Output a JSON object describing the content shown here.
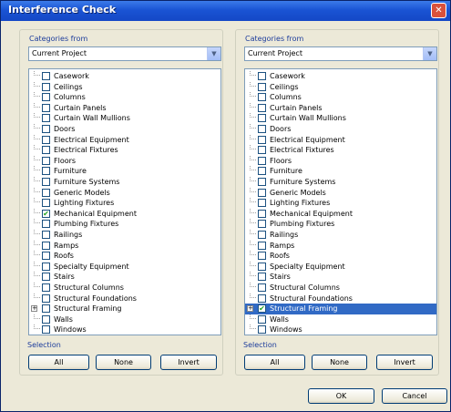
{
  "window": {
    "title": "Interference Check",
    "close_glyph": "✕"
  },
  "left_panel": {
    "categories_label": "Categories from",
    "source": "Current Project",
    "items": [
      {
        "label": "Casework",
        "checked": false,
        "selected": false
      },
      {
        "label": "Ceilings",
        "checked": false,
        "selected": false
      },
      {
        "label": "Columns",
        "checked": false,
        "selected": false
      },
      {
        "label": "Curtain Panels",
        "checked": false,
        "selected": false
      },
      {
        "label": "Curtain Wall Mullions",
        "checked": false,
        "selected": false
      },
      {
        "label": "Doors",
        "checked": false,
        "selected": false
      },
      {
        "label": "Electrical Equipment",
        "checked": false,
        "selected": false
      },
      {
        "label": "Electrical Fixtures",
        "checked": false,
        "selected": false
      },
      {
        "label": "Floors",
        "checked": false,
        "selected": false
      },
      {
        "label": "Furniture",
        "checked": false,
        "selected": false
      },
      {
        "label": "Furniture Systems",
        "checked": false,
        "selected": false
      },
      {
        "label": "Generic Models",
        "checked": false,
        "selected": false
      },
      {
        "label": "Lighting Fixtures",
        "checked": false,
        "selected": false
      },
      {
        "label": "Mechanical Equipment",
        "checked": true,
        "selected": false
      },
      {
        "label": "Plumbing Fixtures",
        "checked": false,
        "selected": false
      },
      {
        "label": "Railings",
        "checked": false,
        "selected": false
      },
      {
        "label": "Ramps",
        "checked": false,
        "selected": false
      },
      {
        "label": "Roofs",
        "checked": false,
        "selected": false
      },
      {
        "label": "Specialty Equipment",
        "checked": false,
        "selected": false
      },
      {
        "label": "Stairs",
        "checked": false,
        "selected": false
      },
      {
        "label": "Structural Columns",
        "checked": false,
        "selected": false
      },
      {
        "label": "Structural Foundations",
        "checked": false,
        "selected": false
      },
      {
        "label": "Structural Framing",
        "checked": false,
        "selected": false,
        "expandable": true
      },
      {
        "label": "Walls",
        "checked": false,
        "selected": false
      },
      {
        "label": "Windows",
        "checked": false,
        "selected": false
      }
    ],
    "selection_label": "Selection",
    "buttons": {
      "all": "All",
      "none": "None",
      "invert": "Invert"
    }
  },
  "right_panel": {
    "categories_label": "Categories from",
    "source": "Current Project",
    "items": [
      {
        "label": "Casework",
        "checked": false,
        "selected": false
      },
      {
        "label": "Ceilings",
        "checked": false,
        "selected": false
      },
      {
        "label": "Columns",
        "checked": false,
        "selected": false
      },
      {
        "label": "Curtain Panels",
        "checked": false,
        "selected": false
      },
      {
        "label": "Curtain Wall Mullions",
        "checked": false,
        "selected": false
      },
      {
        "label": "Doors",
        "checked": false,
        "selected": false
      },
      {
        "label": "Electrical Equipment",
        "checked": false,
        "selected": false
      },
      {
        "label": "Electrical Fixtures",
        "checked": false,
        "selected": false
      },
      {
        "label": "Floors",
        "checked": false,
        "selected": false
      },
      {
        "label": "Furniture",
        "checked": false,
        "selected": false
      },
      {
        "label": "Furniture Systems",
        "checked": false,
        "selected": false
      },
      {
        "label": "Generic Models",
        "checked": false,
        "selected": false
      },
      {
        "label": "Lighting Fixtures",
        "checked": false,
        "selected": false
      },
      {
        "label": "Mechanical Equipment",
        "checked": false,
        "selected": false
      },
      {
        "label": "Plumbing Fixtures",
        "checked": false,
        "selected": false
      },
      {
        "label": "Railings",
        "checked": false,
        "selected": false
      },
      {
        "label": "Ramps",
        "checked": false,
        "selected": false
      },
      {
        "label": "Roofs",
        "checked": false,
        "selected": false
      },
      {
        "label": "Specialty Equipment",
        "checked": false,
        "selected": false
      },
      {
        "label": "Stairs",
        "checked": false,
        "selected": false
      },
      {
        "label": "Structural Columns",
        "checked": false,
        "selected": false
      },
      {
        "label": "Structural Foundations",
        "checked": false,
        "selected": false
      },
      {
        "label": "Structural Framing",
        "checked": true,
        "selected": true,
        "expandable": true
      },
      {
        "label": "Walls",
        "checked": false,
        "selected": false
      },
      {
        "label": "Windows",
        "checked": false,
        "selected": false
      }
    ],
    "selection_label": "Selection",
    "buttons": {
      "all": "All",
      "none": "None",
      "invert": "Invert"
    }
  },
  "footer": {
    "ok_label": "OK",
    "cancel_label": "Cancel"
  },
  "icons": {
    "dropdown": "chevron-down-icon",
    "check": "checkmark-icon",
    "expand": "plus-expander-icon"
  },
  "colors": {
    "titlebar": "#1a54d4",
    "selection": "#316ac5",
    "group_label": "#1d3d9c",
    "checkmark": "#21a121"
  }
}
